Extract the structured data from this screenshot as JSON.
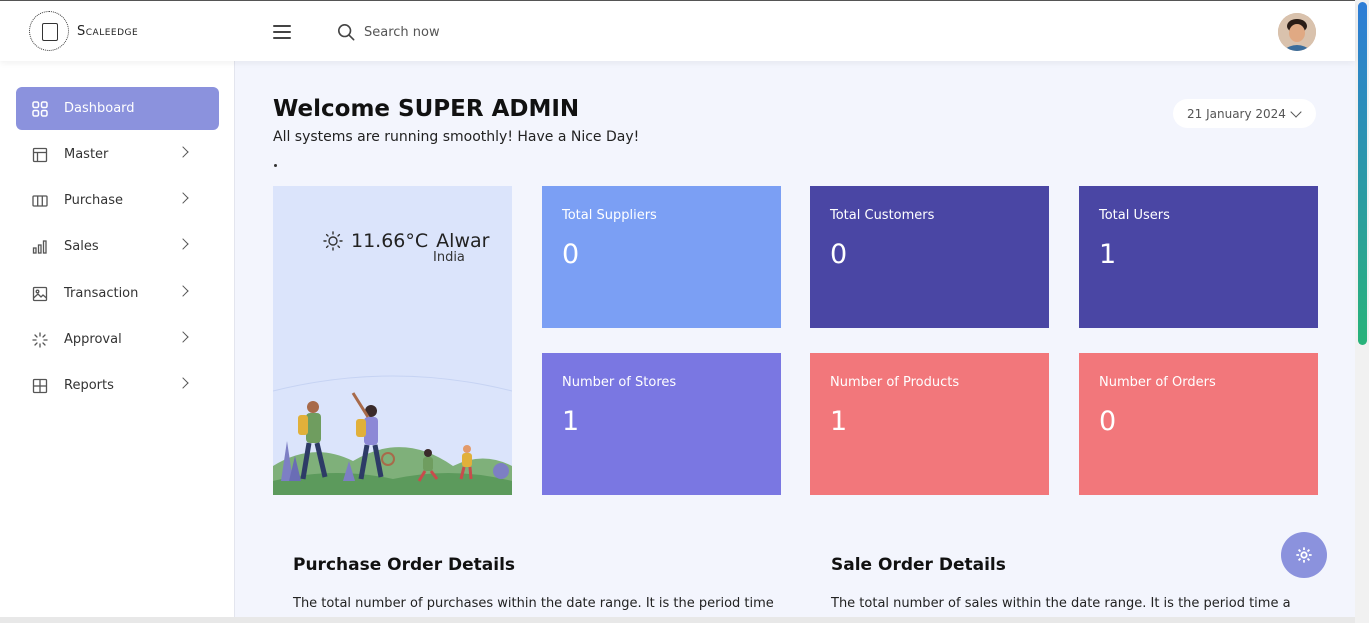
{
  "brand": {
    "name": "Scaleedge"
  },
  "search": {
    "placeholder": "Search now"
  },
  "sidebar": {
    "items": [
      {
        "label": "Dashboard",
        "active": true,
        "icon": "grid-icon"
      },
      {
        "label": "Master",
        "icon": "layout-icon"
      },
      {
        "label": "Purchase",
        "icon": "columns-icon"
      },
      {
        "label": "Sales",
        "icon": "bar-chart-icon"
      },
      {
        "label": "Transaction",
        "icon": "image-icon"
      },
      {
        "label": "Approval",
        "icon": "loader-icon"
      },
      {
        "label": "Reports",
        "icon": "table-icon"
      }
    ]
  },
  "welcome": {
    "title": "Welcome SUPER ADMIN",
    "subtitle": "All systems are running smoothly! Have a Nice Day!"
  },
  "date": {
    "value": "21 January 2024"
  },
  "weather": {
    "temp": "11.66°C",
    "city": "Alwar",
    "country": "India",
    "icon": "sun-icon"
  },
  "cards": [
    {
      "label": "Total Suppliers",
      "value": "0",
      "color": "#7b9ff4"
    },
    {
      "label": "Total Customers",
      "value": "0",
      "color": "#4a46a4"
    },
    {
      "label": "Total Users",
      "value": "1",
      "color": "#4a46a4"
    },
    {
      "label": "Number of Stores",
      "value": "1",
      "color": "#7a77e2"
    },
    {
      "label": "Number of Products",
      "value": "1",
      "color": "#f2777b"
    },
    {
      "label": "Number of Orders",
      "value": "0",
      "color": "#f2777b"
    }
  ],
  "sections": {
    "purchase": {
      "title": "Purchase Order Details",
      "text": "The total number of purchases within the date range. It is the period time"
    },
    "sale": {
      "title": "Sale Order Details",
      "text": "The total number of sales within the date range. It is the period time a"
    }
  },
  "colors": {
    "accent": "#8b92dd",
    "background": "#f3f5fd"
  }
}
